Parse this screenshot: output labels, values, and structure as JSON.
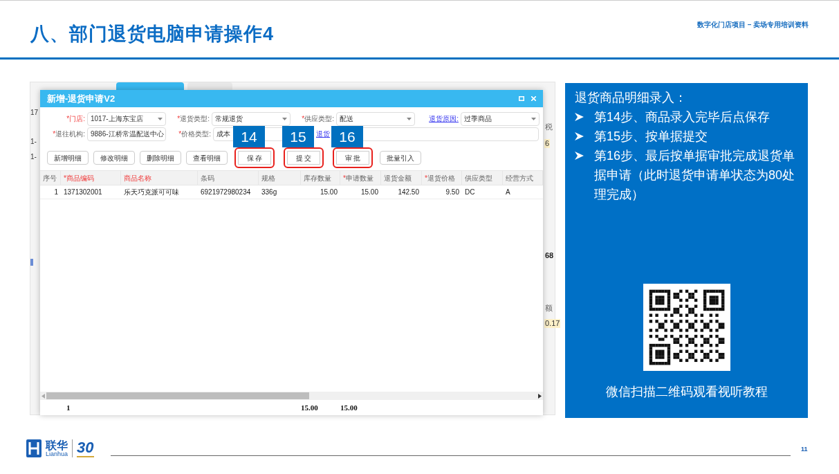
{
  "slide": {
    "title": "八、部门退货电脑申请操作4",
    "subtitle": "数字化门店项目 – 卖场专用培训资料",
    "page_number": "11"
  },
  "logo": {
    "name": "联华",
    "latin": "Lianhua",
    "anniversary": "30"
  },
  "background_app": {
    "left_fragments": [
      "17",
      "1-",
      "1-"
    ],
    "right_fragments": [
      {
        "text": "税",
        "kind": "header"
      },
      {
        "text": "6",
        "kind": "highlight"
      },
      {
        "text": "68",
        "kind": "bold"
      },
      {
        "text": "额",
        "kind": "header"
      },
      {
        "text": "0.17",
        "kind": "highlight"
      }
    ]
  },
  "dialog": {
    "title": "新增-退货申请V2",
    "form_rows": [
      [
        {
          "label": {
            "text": "门店:",
            "kind": "error",
            "mark": "*"
          },
          "value": "1017-上海东宝店",
          "kind": "select"
        },
        {
          "label": {
            "text": "退货类型:",
            "kind": "required",
            "mark": "*"
          },
          "value": "常规退货",
          "kind": "select"
        },
        {
          "label": {
            "text": "供应类型:",
            "kind": "required",
            "mark": "*"
          },
          "value": "配送",
          "kind": "select"
        },
        {
          "label": {
            "text": "退货原因:",
            "kind": "link"
          },
          "value": "过季商品",
          "kind": "select"
        }
      ],
      [
        {
          "label": {
            "text": "退往机构:",
            "kind": "required",
            "mark": "*"
          },
          "value": "9886-江桥常温配送中心",
          "kind": "select"
        },
        {
          "label": {
            "text": "价格类型:",
            "kind": "required",
            "mark": "*"
          },
          "value": "成本",
          "kind": "select"
        },
        {
          "label": {
            "text": "退货",
            "kind": "link"
          },
          "kind": "text"
        }
      ]
    ],
    "buttons": [
      {
        "label": "新增明细",
        "highlighted": false
      },
      {
        "label": "修改明细",
        "highlighted": false
      },
      {
        "label": "删除明细",
        "highlighted": false
      },
      {
        "label": "查看明细",
        "highlighted": false
      },
      {
        "label": "保 存",
        "highlighted": true,
        "step": "14"
      },
      {
        "label": "提 交",
        "highlighted": true,
        "step": "15"
      },
      {
        "label": "审 批",
        "highlighted": true,
        "step": "16"
      },
      {
        "label": "批量引入",
        "highlighted": false
      }
    ],
    "columns": [
      {
        "label": "序号",
        "kind": "plain"
      },
      {
        "label": "商品编码",
        "kind": "error",
        "mark": "*"
      },
      {
        "label": "商品名称",
        "kind": "highlight"
      },
      {
        "label": "条码",
        "kind": "plain"
      },
      {
        "label": "规格",
        "kind": "plain"
      },
      {
        "label": "库存数量",
        "kind": "plain"
      },
      {
        "label": "申请数量",
        "kind": "required",
        "mark": "*"
      },
      {
        "label": "退货金额",
        "kind": "plain"
      },
      {
        "label": "退货价格",
        "kind": "required",
        "mark": "*"
      },
      {
        "label": "供应类型",
        "kind": "plain"
      },
      {
        "label": "经营方式",
        "kind": "plain"
      }
    ],
    "rows": [
      [
        "1",
        "1371302001",
        "乐天巧克派可可味",
        "6921972980234",
        "336g",
        "15.00",
        "15.00",
        "142.50",
        "9.50",
        "DC",
        "A"
      ]
    ],
    "totals": {
      "count": "1",
      "stock_qty": "15.00",
      "apply_qty": "15.00"
    }
  },
  "instructions": {
    "heading": "退货商品明细录入：",
    "items": [
      "第14步、商品录入完毕后点保存",
      "第15步、按单据提交",
      "第16步、最后按单据审批完成退货单据申请（此时退货申请单状态为80处理完成）"
    ],
    "qr_caption": "微信扫描二维码观看视听教程"
  }
}
